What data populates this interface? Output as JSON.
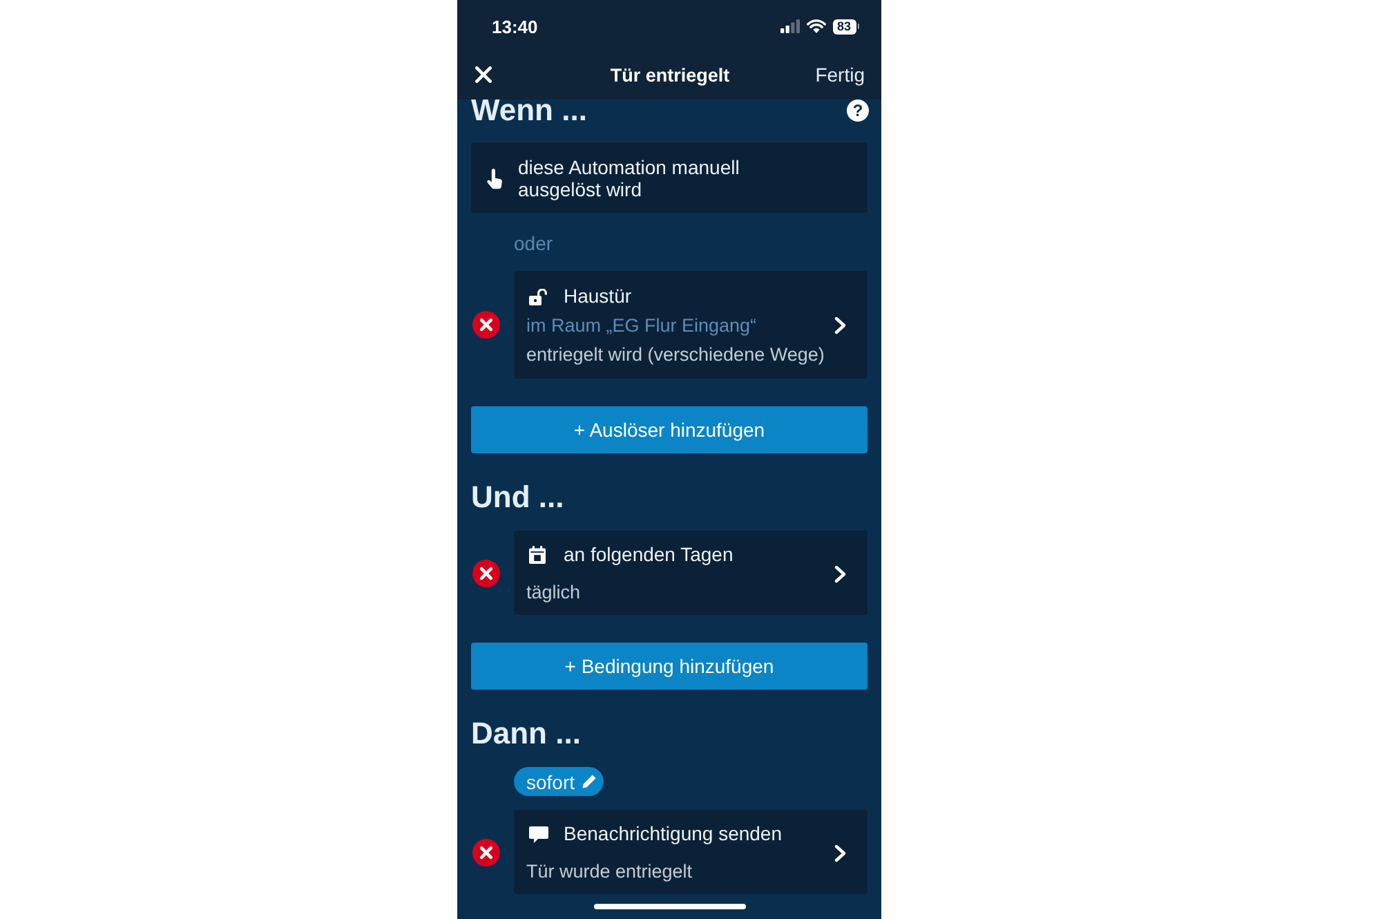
{
  "status_bar": {
    "time": "13:40",
    "battery": "83"
  },
  "nav_bar": {
    "title": "Tür entriegelt",
    "action": "Fertig"
  },
  "sections": [
    {
      "heading": "Wenn ...",
      "help": "?",
      "items": [
        {
          "kind": "manual",
          "removable": false,
          "chevron": false,
          "title": "diese Automation manuell ausgelöst wird"
        },
        {
          "kind": "separator",
          "text": "oder"
        },
        {
          "kind": "lock",
          "removable": true,
          "chevron": true,
          "title": "Haustür",
          "room": "im Raum „EG Flur Eingang“",
          "detail": "entriegelt wird (verschiedene Wege)"
        },
        {
          "kind": "add",
          "label": "+ Auslöser hinzufügen"
        }
      ]
    },
    {
      "heading": "Und ...",
      "items": [
        {
          "kind": "calendar",
          "removable": true,
          "chevron": true,
          "title": "an folgenden Tagen",
          "detail": "täglich"
        },
        {
          "kind": "add",
          "label": "+ Bedingung hinzufügen"
        }
      ]
    },
    {
      "heading": "Dann ...",
      "items": [
        {
          "kind": "chip",
          "label": "sofort"
        },
        {
          "kind": "message",
          "removable": true,
          "chevron": true,
          "title": "Benachrichtigung senden",
          "detail": "Tür wurde entriegelt"
        }
      ]
    }
  ]
}
